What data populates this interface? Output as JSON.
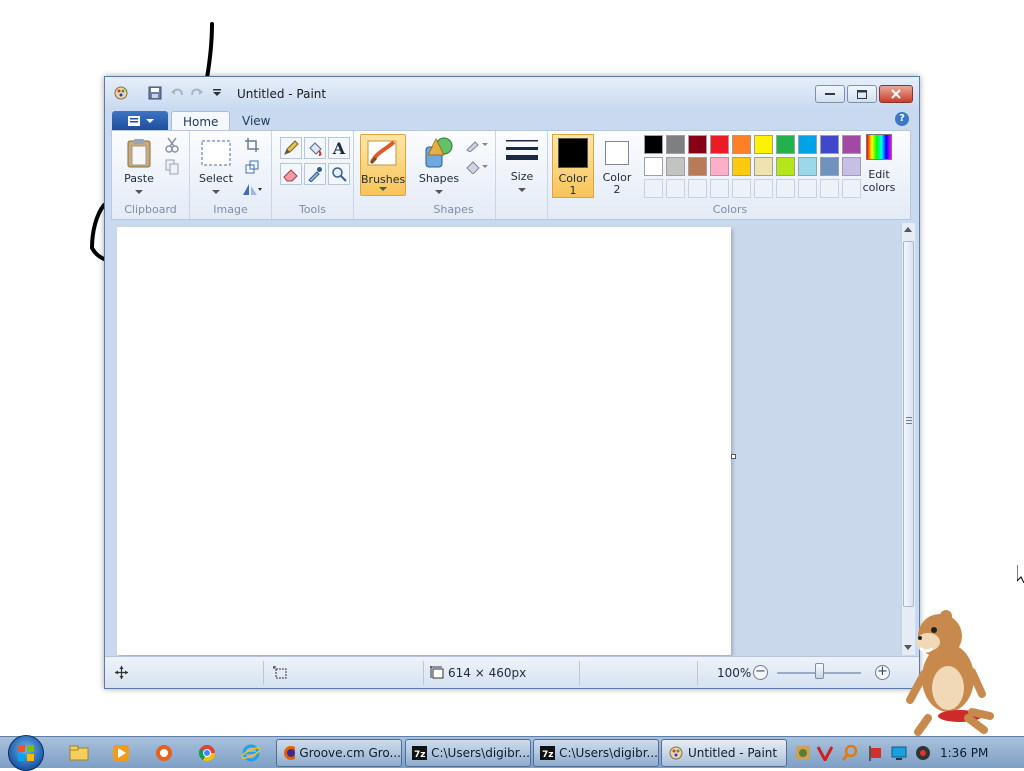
{
  "window": {
    "title": "Untitled - Paint",
    "controls": [
      "minimize",
      "maximize",
      "close"
    ]
  },
  "tabs": [
    {
      "label": "Home",
      "active": true
    },
    {
      "label": "View",
      "active": false
    }
  ],
  "ribbon": {
    "groups": {
      "clipboard": {
        "label": "Clipboard",
        "paste_label": "Paste"
      },
      "image": {
        "label": "Image",
        "select_label": "Select"
      },
      "tools": {
        "label": "Tools"
      },
      "brushes": {
        "label": "Brushes"
      },
      "shapes": {
        "label": "Shapes",
        "shapes_label": "Shapes"
      },
      "size": {
        "label": "Size"
      },
      "colors": {
        "label": "Colors",
        "color1_line1": "Color",
        "color1_line2": "1",
        "color2_line1": "Color",
        "color2_line2": "2",
        "edit_line1": "Edit",
        "edit_line2": "colors",
        "color1_value": "#000000",
        "color2_value": "#ffffff",
        "palette_row1": [
          "#000000",
          "#7f7f7f",
          "#880015",
          "#ed1c24",
          "#ff7f27",
          "#fff200",
          "#22b14c",
          "#00a2e8",
          "#3f48cc",
          "#a349a4"
        ],
        "palette_row2": [
          "#ffffff",
          "#c3c3c3",
          "#b97a57",
          "#ffaec9",
          "#ffc90e",
          "#efe4b0",
          "#b5e61d",
          "#99d9ea",
          "#7092be",
          "#c8bfe7"
        ]
      }
    }
  },
  "canvas": {
    "background": "#ffffff"
  },
  "statusbar": {
    "dimensions": "614 × 460px",
    "zoom": "100%",
    "zoom_level_fraction": 0.5
  },
  "taskbar": {
    "tasks": [
      {
        "label": "Groove.cm Gro...",
        "icon": "firefox-icon"
      },
      {
        "label": "C:\\Users\\digibr...",
        "icon": "7zip-icon"
      },
      {
        "label": "C:\\Users\\digibr...",
        "icon": "7zip-icon"
      },
      {
        "label": "Untitled - Paint",
        "icon": "paint-icon",
        "active": true
      }
    ],
    "clock": "1:36 PM"
  },
  "colors": {
    "accent": "#f8c45a",
    "window_frame": "#c9daf0",
    "taskbar": "#7e9fc6"
  }
}
